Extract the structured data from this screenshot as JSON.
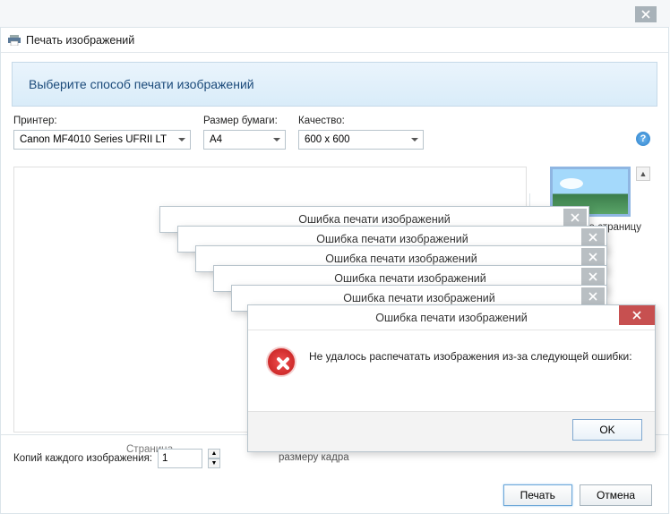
{
  "window": {
    "title": "Печать изображений"
  },
  "banner": {
    "text": "Выберите способ печати изображений"
  },
  "form": {
    "printer_label": "Принтер:",
    "printer_value": "Canon MF4010 Series UFRII LT",
    "paper_label": "Размер бумаги:",
    "paper_value": "A4",
    "quality_label": "Качество:",
    "quality_value": "600 x 600"
  },
  "thumb": {
    "label": "о страницу"
  },
  "copies": {
    "label": "Копий каждого изображения:",
    "value": "1"
  },
  "size_label": "размеру кадра",
  "page_caption": "Страница",
  "footer": {
    "print": "Печать",
    "cancel": "Отмена"
  },
  "error": {
    "title": "Ошибка печати изображений",
    "message": "Не удалось распечатать изображения из-за следующей ошибки:",
    "ok": "OK"
  }
}
